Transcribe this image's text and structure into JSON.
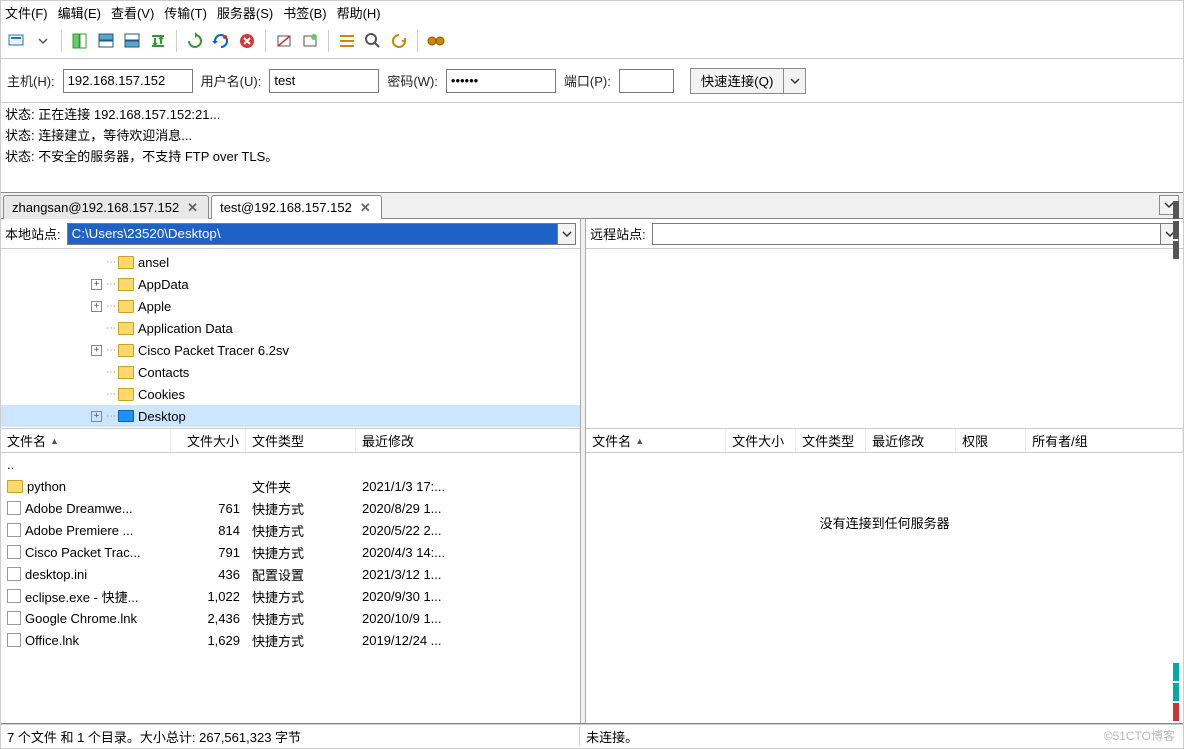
{
  "menu": [
    "文件(F)",
    "编辑(E)",
    "查看(V)",
    "传输(T)",
    "服务器(S)",
    "书签(B)",
    "帮助(H)"
  ],
  "conn": {
    "host_label": "主机(H):",
    "host": "192.168.157.152",
    "user_label": "用户名(U):",
    "user": "test",
    "pass_label": "密码(W):",
    "pass": "••••••",
    "port_label": "端口(P):",
    "port": "",
    "quick_label": "快速连接(Q)"
  },
  "log": [
    "状态:  正在连接 192.168.157.152:21...",
    "状态:  连接建立，等待欢迎消息...",
    "状态:  不安全的服务器，不支持 FTP over TLS。"
  ],
  "tabs": [
    {
      "label": "zhangsan@192.168.157.152",
      "active": false
    },
    {
      "label": "test@192.168.157.152",
      "active": true
    }
  ],
  "local": {
    "site_label": "本地站点:",
    "path": "C:\\Users\\23520\\Desktop\\",
    "tree": [
      {
        "name": "ansel",
        "exp": "none",
        "icon": "folder"
      },
      {
        "name": "AppData",
        "exp": "+",
        "icon": "folder"
      },
      {
        "name": "Apple",
        "exp": "+",
        "icon": "folder"
      },
      {
        "name": "Application Data",
        "exp": "none",
        "icon": "folder"
      },
      {
        "name": "Cisco Packet Tracer 6.2sv",
        "exp": "+",
        "icon": "folder"
      },
      {
        "name": "Contacts",
        "exp": "none",
        "icon": "folder"
      },
      {
        "name": "Cookies",
        "exp": "none",
        "icon": "folder"
      },
      {
        "name": "Desktop",
        "exp": "+",
        "icon": "desktop",
        "selected": true
      }
    ],
    "cols": {
      "name": "文件名",
      "size": "文件大小",
      "type": "文件类型",
      "date": "最近修改"
    },
    "files": [
      {
        "name": "..",
        "size": "",
        "type": "",
        "date": ""
      },
      {
        "name": "python",
        "size": "",
        "type": "文件夹",
        "date": "2021/1/3 17:..."
      },
      {
        "name": "Adobe Dreamwe...",
        "size": "761",
        "type": "快捷方式",
        "date": "2020/8/29 1..."
      },
      {
        "name": "Adobe Premiere ...",
        "size": "814",
        "type": "快捷方式",
        "date": "2020/5/22 2..."
      },
      {
        "name": "Cisco Packet Trac...",
        "size": "791",
        "type": "快捷方式",
        "date": "2020/4/3 14:..."
      },
      {
        "name": "desktop.ini",
        "size": "436",
        "type": "配置设置",
        "date": "2021/3/12 1..."
      },
      {
        "name": "eclipse.exe - 快捷...",
        "size": "1,022",
        "type": "快捷方式",
        "date": "2020/9/30 1..."
      },
      {
        "name": "Google Chrome.lnk",
        "size": "2,436",
        "type": "快捷方式",
        "date": "2020/10/9 1..."
      },
      {
        "name": "Office.lnk",
        "size": "1,629",
        "type": "快捷方式",
        "date": "2019/12/24 ..."
      }
    ]
  },
  "remote": {
    "site_label": "远程站点:",
    "cols": {
      "name": "文件名",
      "size": "文件大小",
      "type": "文件类型",
      "date": "最近修改",
      "perm": "权限",
      "owner": "所有者/组"
    },
    "empty_msg": "没有连接到任何服务器"
  },
  "status": {
    "left": "7 个文件 和 1 个目录。大小总计: 267,561,323 字节",
    "right": "未连接。"
  },
  "watermark": "©51CTO博客"
}
